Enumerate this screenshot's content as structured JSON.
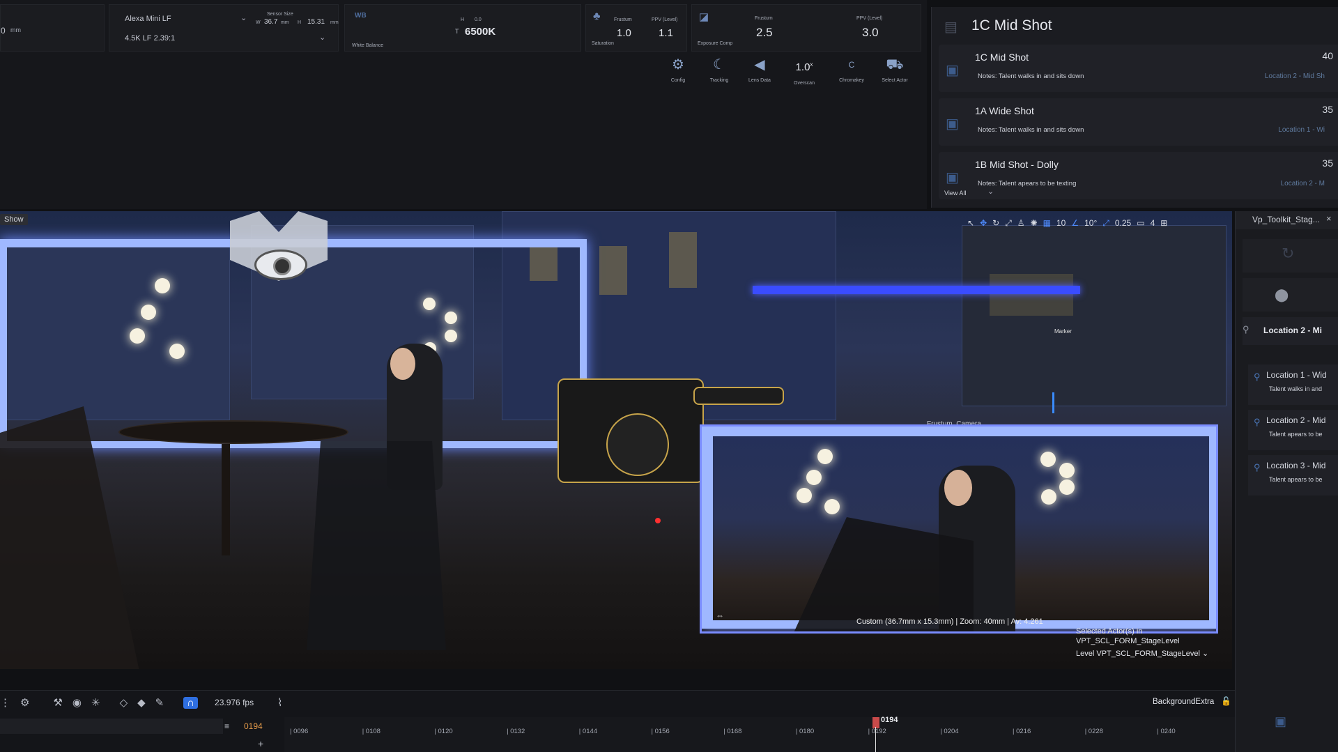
{
  "camera": {
    "focal_unit": "mm",
    "body": "Alexa Mini LF",
    "format": "4.5K LF 2.39:1",
    "sensor_size_label": "Sensor Size",
    "sensor_w_label": "W",
    "sensor_w_value": "36.7",
    "sensor_w_unit": "mm",
    "sensor_h_label": "H",
    "sensor_h_value": "15.31",
    "sensor_h_unit": "mm"
  },
  "white_balance": {
    "tag": "WB",
    "label": "White Balance",
    "h_label": "H",
    "h_value": "0.0",
    "t_label": "T",
    "t_value": "6500K"
  },
  "saturation": {
    "frustum_label": "Frustum",
    "frustum_value": "1.0",
    "ppv_label": "PPV (Level)",
    "ppv_value": "1.1",
    "label": "Saturation"
  },
  "exposure": {
    "frustum_label": "Frustum",
    "frustum_value": "2.5",
    "ppv_label": "PPV (Level)",
    "ppv_value": "3.0",
    "label": "Exposure Comp"
  },
  "tools": [
    {
      "icon": "gear-icon",
      "glyph": "⚙",
      "label": "Config"
    },
    {
      "icon": "tracking-icon",
      "glyph": "☾",
      "label": "Tracking"
    },
    {
      "icon": "lens-icon",
      "glyph": "◀",
      "label": "Lens Data"
    },
    {
      "icon": "overscan-icon",
      "glyph": "1.0",
      "label": "Overscan"
    },
    {
      "icon": "chromakey-icon",
      "glyph": "C",
      "label": "Chromakey"
    },
    {
      "icon": "select-actor-icon",
      "glyph": "⛟",
      "label": "Select Actor"
    }
  ],
  "overscan_suffix": "x",
  "shots": {
    "current_title": "1C Mid Shot",
    "view_all": "View All",
    "items": [
      {
        "name": "1C Mid Shot",
        "notes": "Notes: Talent walks in and sits down",
        "location": "Location 2 - Mid Sh",
        "num": "40"
      },
      {
        "name": "1A Wide Shot",
        "notes": "Notes: Talent walks in and sits down",
        "location": "Location 1 - Wi",
        "num": "35"
      },
      {
        "name": "1B Mid Shot - Dolly",
        "notes": "Notes: Talent apears to be texting",
        "location": "Location 2 - M",
        "num": "35"
      }
    ]
  },
  "viewport": {
    "show_label": "Show",
    "grid_value": "10",
    "angle_value": "10°",
    "scale_value": "0.25",
    "camera_speed": "4",
    "marker_label": "Marker",
    "frustum_camera_label": "Frustum_Camera",
    "pip_info": "Custom (36.7mm x 15.3mm) | Zoom: 40mm | Av: 4.261",
    "selected_line1": "Selected Actor(s) in",
    "selected_line2": "VPT_SCL_FORM_StageLevel",
    "level_label": "Level",
    "level_value": "VPT_SCL_FORM_StageLevel"
  },
  "side_panel": {
    "tab_title": "Vp_Toolkit_Stag...",
    "current_location": "Location 2 - Mi",
    "locations": [
      {
        "title": "Location 1 - Wid",
        "desc": "Talent walks in and"
      },
      {
        "title": "Location 2 - Mid",
        "desc": "Talent apears to be"
      },
      {
        "title": "Location 3 - Mid",
        "desc": "Talent apears to be"
      }
    ]
  },
  "timeline": {
    "fps": "23.976 fps",
    "current_frame": "0194",
    "playhead_frame": "0194",
    "track_name": "BackgroundExtra",
    "ticks": [
      "0096",
      "0108",
      "0120",
      "0132",
      "0144",
      "0156",
      "0168",
      "0180",
      "0192",
      "0204",
      "0216",
      "0228",
      "0240"
    ]
  },
  "colors": {
    "accent": "#2f6fe0",
    "frame_glow": "#9fb8ff",
    "playhead": "#c84a4a"
  }
}
